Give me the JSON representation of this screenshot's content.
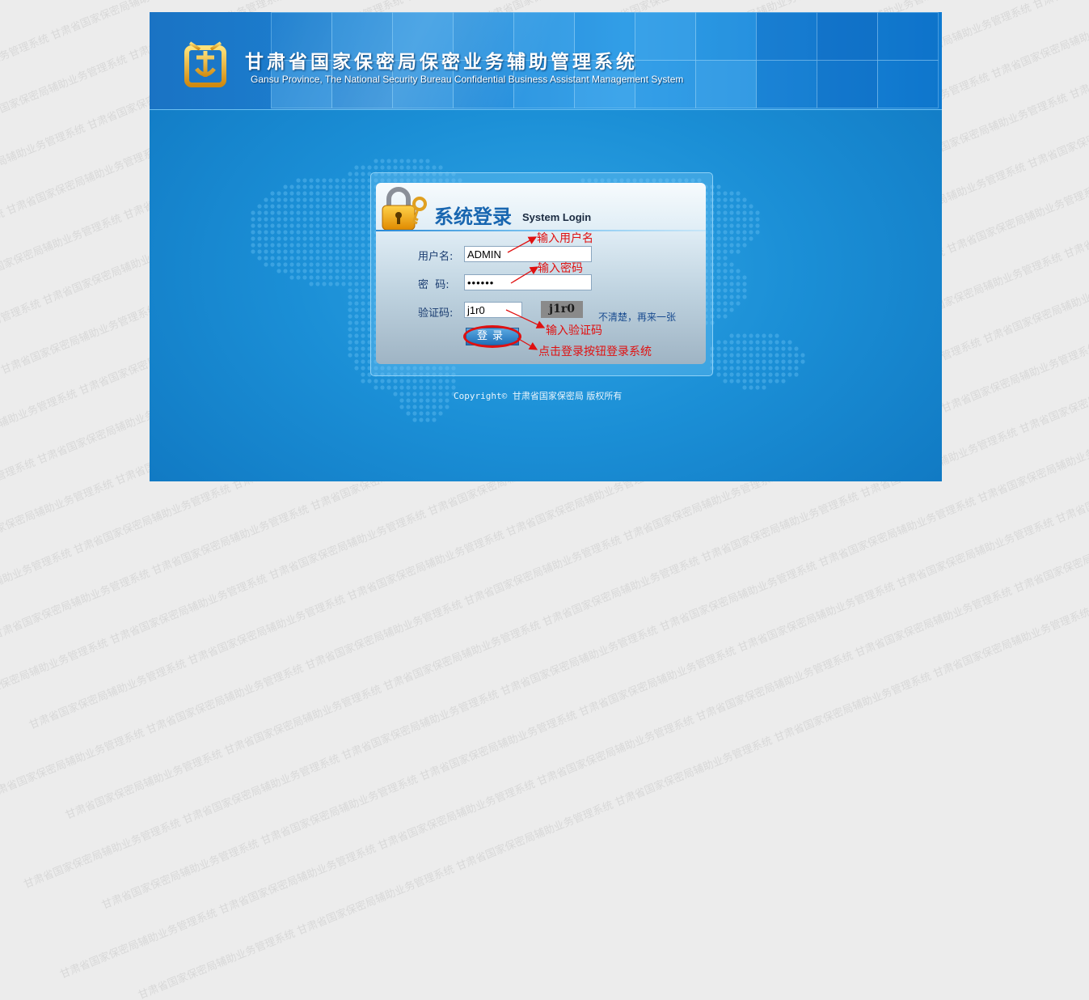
{
  "watermark": "甘肃省国家保密局辅助业务管理系统",
  "header": {
    "title_cn": "甘肃省国家保密局保密业务辅助管理系统",
    "title_en": "Gansu Province, The National Security Bureau Confidential Business Assistant Management System",
    "logo_icon": "seal-logo-icon"
  },
  "login": {
    "title_cn": "系统登录",
    "title_en": "System  Login",
    "username_label": "用户名:",
    "username_value": "ADMIN",
    "password_label": "密  码:",
    "password_value": "••••••",
    "captcha_label": "验证码:",
    "captcha_value": "j1r0",
    "captcha_image_text": "j1r0",
    "refresh_link": "不清楚，再来一张",
    "login_button": "登录"
  },
  "annotations": {
    "username": "输入用户名",
    "password": "输入密码",
    "captcha": "输入验证码",
    "login": "点击登录按钮登录系统"
  },
  "footer": {
    "copyright_prefix": "Copyright©",
    "copyright_org": "甘肃省国家保密局 版权所有"
  },
  "colors": {
    "accent": "#1866b0",
    "annotation": "#e01010",
    "background": "#1b8fd6"
  }
}
